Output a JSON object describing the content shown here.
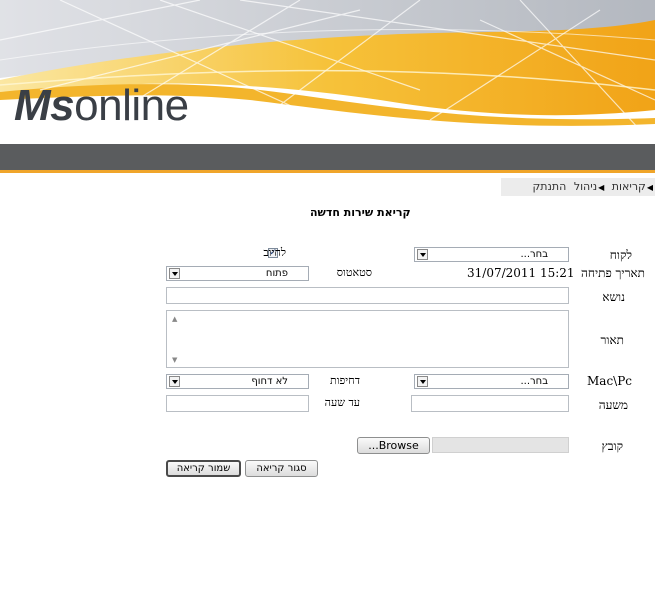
{
  "header": {
    "logo_bold": "Ms",
    "logo_rest": "online"
  },
  "nav": {
    "items": [
      "קריאות",
      "ניהול",
      "התנתק"
    ]
  },
  "page_title": "קריאת שירות חדשה",
  "form": {
    "customer_label": "לקוח",
    "customer_value": "בחר...",
    "charge_label": "לחיוב",
    "charge_checked": true,
    "open_date_label": "תאריך פתיחה",
    "open_date_value": "31/07/2011 15:21",
    "status_label": "סטאטוס",
    "status_value": "פתוח",
    "subject_label": "נושא",
    "subject_value": "",
    "description_label": "תאור",
    "description_value": "",
    "macpc_label": "Mac\\Pc",
    "macpc_value": "בחר...",
    "urgency_label": "דחיפות",
    "urgency_value": "לא דחוף",
    "from_hour_label": "משעה",
    "from_hour_value": "",
    "to_hour_label": "עד שעה",
    "to_hour_value": "",
    "file_label": "קובץ",
    "browse_label": "Browse...",
    "close_button": "סגור קריאה",
    "save_button": "שמור קריאה"
  },
  "colors": {
    "dark_bar": "#5a5c5e",
    "accent_orange": "#f0a52a",
    "logo_text": "#3a3f46"
  }
}
